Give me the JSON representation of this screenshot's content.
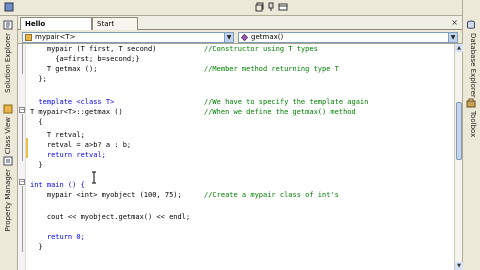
{
  "tabs": [
    {
      "label": "Hello World.cpp",
      "active": true
    },
    {
      "label": "Start Page",
      "active": false
    }
  ],
  "tab_close": "×",
  "nav": {
    "class_combo": "mypair<T>",
    "member_combo": "getmax()"
  },
  "left_panel": [
    "Solution Explorer",
    "Class View",
    "Property Manager"
  ],
  "right_panel": [
    "Database Explorer",
    "Toolbox"
  ],
  "code_lines": [
    {
      "text": "    mypair (T first, T second)",
      "comment": "//Constructor using T types"
    },
    {
      "text": "      {a=first; b=second;}",
      "comment": ""
    },
    {
      "text": "    T getmax ();",
      "comment": "//Member method returning type T"
    },
    {
      "text": "  };",
      "comment": ""
    },
    {
      "text": "",
      "comment": ""
    },
    {
      "text": "  template <class T>",
      "comment": "//We have to specify the template again"
    },
    {
      "text": "T mypair<T>::getmax ()",
      "comment": "//When we define the getmax() method"
    },
    {
      "text": "  {",
      "comment": ""
    },
    {
      "text": "    T retval;",
      "comment": ""
    },
    {
      "text": "    retval = a>b? a : b;",
      "comment": ""
    },
    {
      "text": "    return retval;",
      "comment": ""
    },
    {
      "text": "  }",
      "comment": ""
    },
    {
      "text": "",
      "comment": ""
    },
    {
      "text": "int main () {",
      "comment": ""
    },
    {
      "text": "    mypair <int> myobject (100, 75);",
      "comment": "//Create a mypair class of int's"
    },
    {
      "text": "",
      "comment": ""
    },
    {
      "text": "    cout << myobject.getmax() << endl;",
      "comment": ""
    },
    {
      "text": "",
      "comment": ""
    },
    {
      "text": "    return 0;",
      "comment": ""
    },
    {
      "text": "  }",
      "comment": ""
    }
  ],
  "colors": {
    "keyword": "#0000ff",
    "comment": "#008000",
    "text": "#000000"
  }
}
